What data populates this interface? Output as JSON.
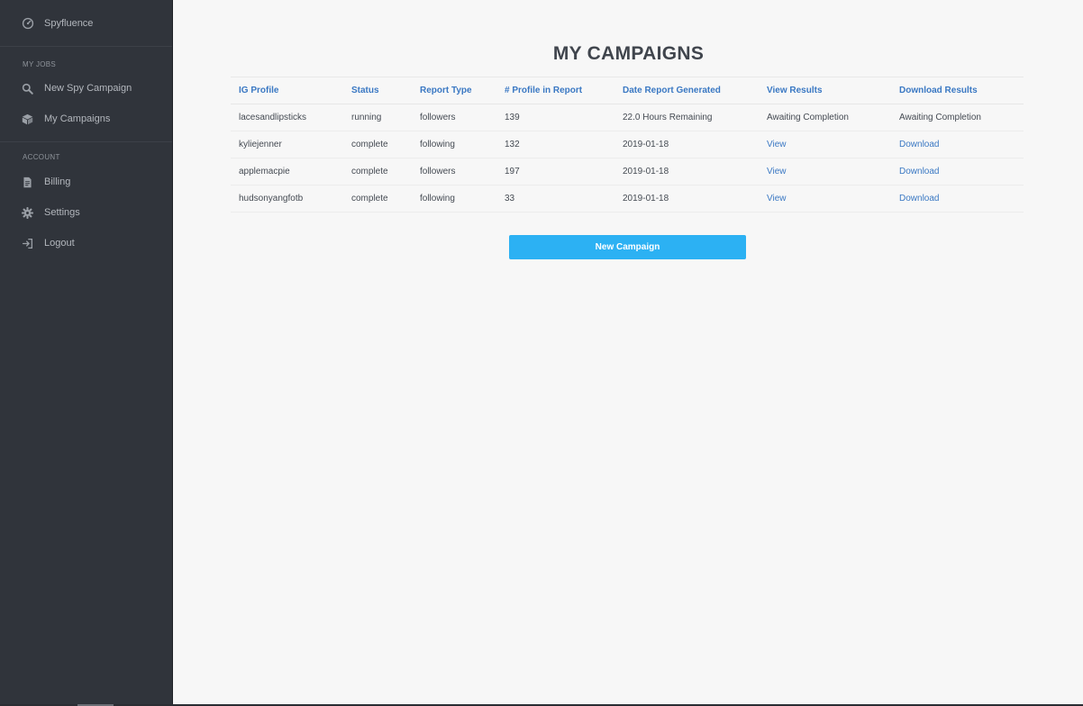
{
  "sidebar": {
    "brand": "Spyfluence",
    "sections": [
      {
        "label": "MY JOBS",
        "items": [
          {
            "label": "New Spy Campaign",
            "icon": "search-icon"
          },
          {
            "label": "My Campaigns",
            "icon": "cube-icon"
          }
        ]
      },
      {
        "label": "ACCOUNT",
        "items": [
          {
            "label": "Billing",
            "icon": "document-icon"
          },
          {
            "label": "Settings",
            "icon": "gear-icon"
          },
          {
            "label": "Logout",
            "icon": "logout-icon"
          }
        ]
      }
    ]
  },
  "main": {
    "title": "MY CAMPAIGNS",
    "table": {
      "headers": [
        "IG Profile",
        "Status",
        "Report Type",
        "# Profile in Report",
        "Date Report Generated",
        "View Results",
        "Download Results"
      ],
      "rows": [
        {
          "profile": "lacesandlipsticks",
          "status": "running",
          "report_type": "followers",
          "count": "139",
          "date": "22.0 Hours Remaining",
          "view": "Awaiting Completion",
          "download": "Awaiting Completion"
        },
        {
          "profile": "kyliejenner",
          "status": "complete",
          "report_type": "following",
          "count": "132",
          "date": "2019-01-18",
          "view": "View",
          "download": "Download"
        },
        {
          "profile": "applemacpie",
          "status": "complete",
          "report_type": "followers",
          "count": "197",
          "date": "2019-01-18",
          "view": "View",
          "download": "Download"
        },
        {
          "profile": "hudsonyangfotb",
          "status": "complete",
          "report_type": "following",
          "count": "33",
          "date": "2019-01-18",
          "view": "View",
          "download": "Download"
        }
      ]
    },
    "new_campaign_label": "New Campaign"
  },
  "colors": {
    "sidebar_bg": "#30343b",
    "link": "#3a78c3",
    "button": "#2cb1f3",
    "page_bg": "#f7f7f7"
  }
}
